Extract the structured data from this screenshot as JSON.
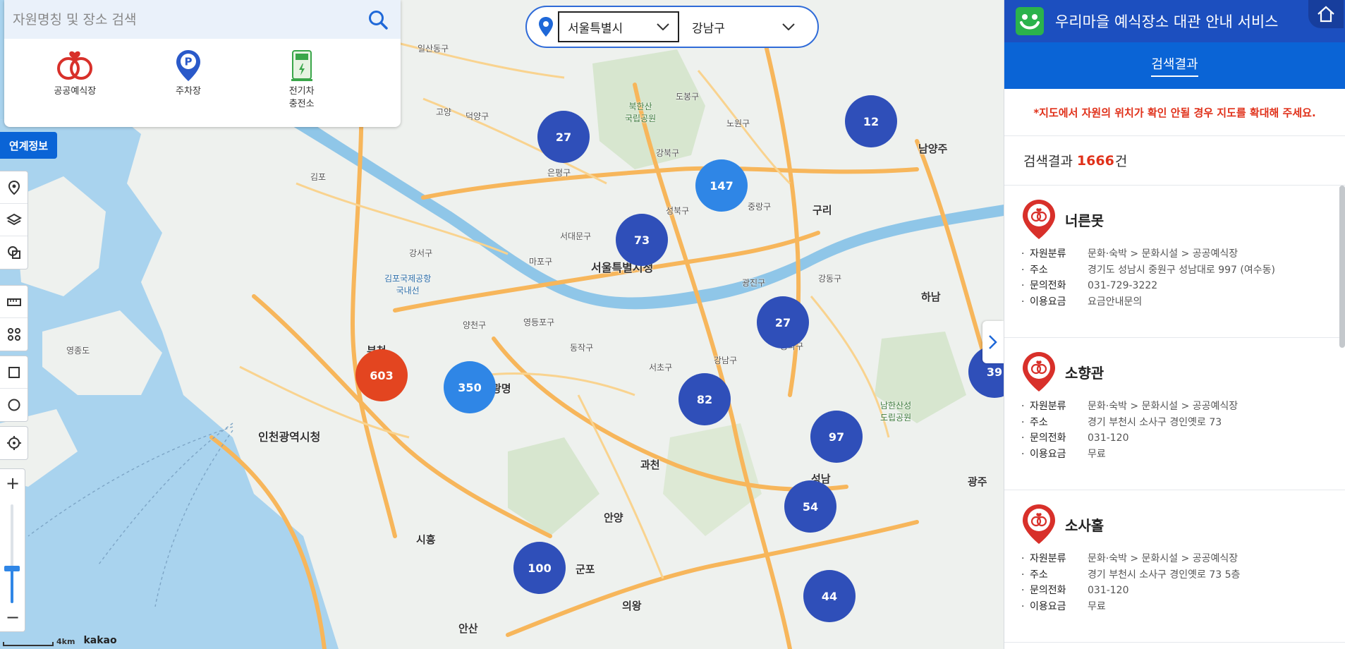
{
  "search": {
    "placeholder": "자원명칭 및 장소 검색",
    "categories": [
      {
        "label": "공공예식장",
        "icon": "wedding-rings-icon"
      },
      {
        "label": "주차장",
        "icon": "parking-pin-icon"
      },
      {
        "label": "전기차\n충전소",
        "icon": "ev-charger-icon"
      }
    ]
  },
  "link_button": "연계정보",
  "region": {
    "city": "서울특별시",
    "district": "강남구"
  },
  "map": {
    "scale_label": "4km",
    "provider": "kakao",
    "zoom_level": 0.35,
    "places": {
      "goyang": "고양",
      "ilsandong": "일산동구",
      "deogyang": "덕양구",
      "gimpo": "김포",
      "gimpo_airport": "김포국제공항\n국내선",
      "gangseo": "강서구",
      "seoul_city_hall": "서울특별시청",
      "incheon_city_hall": "인천광역시청",
      "bucheon": "부천",
      "gwangmyeong": "광명",
      "anyang": "안양",
      "gunpo": "군포",
      "gwacheon": "과천",
      "seongnam": "성남",
      "guri": "구리",
      "hanam": "하남",
      "namyangju": "남양주",
      "gwangju": "광주",
      "siheung": "시흥",
      "uiwang": "의왕",
      "ansan": "안산",
      "yeongdo": "영종도",
      "dongjakgu": "동작구",
      "gangnamgu": "강남구",
      "seochogu": "서초구",
      "mapogu": "마포구",
      "yangcheon": "양천구",
      "yeongdeungpo": "영등포구",
      "gangbuk": "강북구",
      "dobong": "도봉구",
      "nowon": "노원구",
      "jungnang": "중랑구",
      "seongbuk": "성북구",
      "eunpyeong": "은평구",
      "seodaemun": "서대문구",
      "gangdong": "강동구",
      "songpa": "송파구",
      "gwangjin": "광진구",
      "bukhansan": "북한산\n국립공원",
      "namhansanseong": "남한산성\n도립공원"
    },
    "clusters": [
      {
        "count": "27",
        "style": "dark"
      },
      {
        "count": "73",
        "style": "dark"
      },
      {
        "count": "147",
        "style": "light"
      },
      {
        "count": "12",
        "style": "dark"
      },
      {
        "count": "603",
        "style": "red"
      },
      {
        "count": "350",
        "style": "light"
      },
      {
        "count": "27",
        "style": "dark"
      },
      {
        "count": "82",
        "style": "dark"
      },
      {
        "count": "39",
        "style": "dark"
      },
      {
        "count": "97",
        "style": "dark"
      },
      {
        "count": "54",
        "style": "dark"
      },
      {
        "count": "100",
        "style": "dark"
      },
      {
        "count": "44",
        "style": "dark"
      }
    ]
  },
  "panel": {
    "title": "우리마을 예식장소 대관 안내 서비스",
    "tab": "검색결과",
    "notice": "*지도에서 자원의 위치가 확인 안될 경우 지도를 확대해 주세요.",
    "count_prefix": "검색결과",
    "count": "1666",
    "count_suffix": "건",
    "results": [
      {
        "name": "너른못",
        "rows": [
          {
            "label": "자원분류",
            "value": "문화·숙박 > 문화시설 > 공공예식장"
          },
          {
            "label": "주소",
            "value": "경기도 성남시 중원구 성남대로 997 (여수동)"
          },
          {
            "label": "문의전화",
            "value": "031-729-3222"
          },
          {
            "label": "이용요금",
            "value": "요금안내문의"
          }
        ]
      },
      {
        "name": "소향관",
        "rows": [
          {
            "label": "자원분류",
            "value": "문화·숙박 > 문화시설 > 공공예식장"
          },
          {
            "label": "주소",
            "value": "경기 부천시 소사구 경인옛로 73"
          },
          {
            "label": "문의전화",
            "value": "031-120"
          },
          {
            "label": "이용요금",
            "value": "무료"
          }
        ]
      },
      {
        "name": "소사홀",
        "rows": [
          {
            "label": "자원분류",
            "value": "문화·숙박 > 문화시설 > 공공예식장"
          },
          {
            "label": "주소",
            "value": "경기 부천시 소사구 경인옛로 73 5층"
          },
          {
            "label": "문의전화",
            "value": "031-120"
          },
          {
            "label": "이용요금",
            "value": "무료"
          }
        ]
      }
    ]
  },
  "colors": {
    "header": "#1c4fbf",
    "tabbar": "#0a64d6",
    "accent_red": "#e0311a",
    "cluster_dark": "#2f4fb9",
    "cluster_light": "#2f86e6",
    "cluster_red": "#e34520",
    "river": "#8fc6e8"
  }
}
